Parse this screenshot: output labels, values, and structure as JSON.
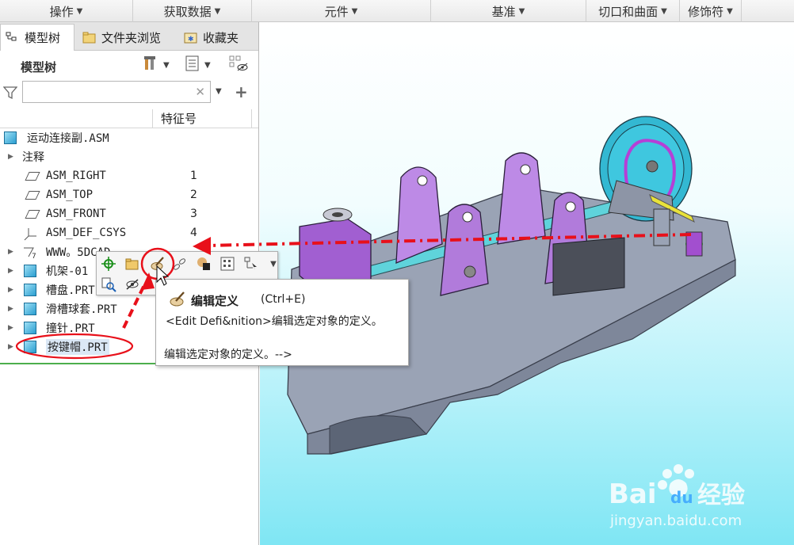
{
  "ribbon": {
    "groups": [
      "操作",
      "获取数据",
      "元件",
      "基准",
      "切口和曲面",
      "修饰符"
    ]
  },
  "tabs": {
    "model_tree": "模型树",
    "folder_browser": "文件夹浏览",
    "favorites": "收藏夹"
  },
  "model_tree": {
    "title": "模型树",
    "search": {
      "value": "",
      "placeholder": ""
    },
    "column_header": "特征号",
    "items": [
      {
        "name": "运动连接副.ASM",
        "num": ""
      },
      {
        "name": "注释",
        "num": ""
      },
      {
        "name": "ASM_RIGHT",
        "num": "1"
      },
      {
        "name": "ASM_TOP",
        "num": "2"
      },
      {
        "name": "ASM_FRONT",
        "num": "3"
      },
      {
        "name": "ASM_DEF_CSYS",
        "num": "4"
      },
      {
        "name": "WWW。5DCAD",
        "num": ""
      },
      {
        "name": "机架-01",
        "num": ""
      },
      {
        "name": "槽盘.PRT",
        "num": ""
      },
      {
        "name": "滑槽球套.PRT",
        "num": ""
      },
      {
        "name": "撞针.PRT",
        "num": ""
      },
      {
        "name": "按键帽.PRT",
        "num": ""
      }
    ]
  },
  "tooltip": {
    "title": "编辑定义",
    "shortcut": "(Ctrl+E)",
    "description": "<Edit Defi&nition>编辑选定对象的定义。",
    "help": "编辑选定对象的定义。-->"
  },
  "icons": {
    "mini_toolbar": [
      "move-icon",
      "open-icon",
      "edit-definition-icon",
      "chain-icon",
      "appearance-icon",
      "pattern-icon",
      "component-icon",
      "hide-icon"
    ]
  },
  "colors": {
    "annotation_red": "#e8101a",
    "selection_green": "#4cae4c",
    "viewport_top": "#ffffff",
    "viewport_bottom": "#7fe6f4"
  },
  "watermark": {
    "brand": "Bai du 经验",
    "url": "jingyan.baidu.com"
  }
}
